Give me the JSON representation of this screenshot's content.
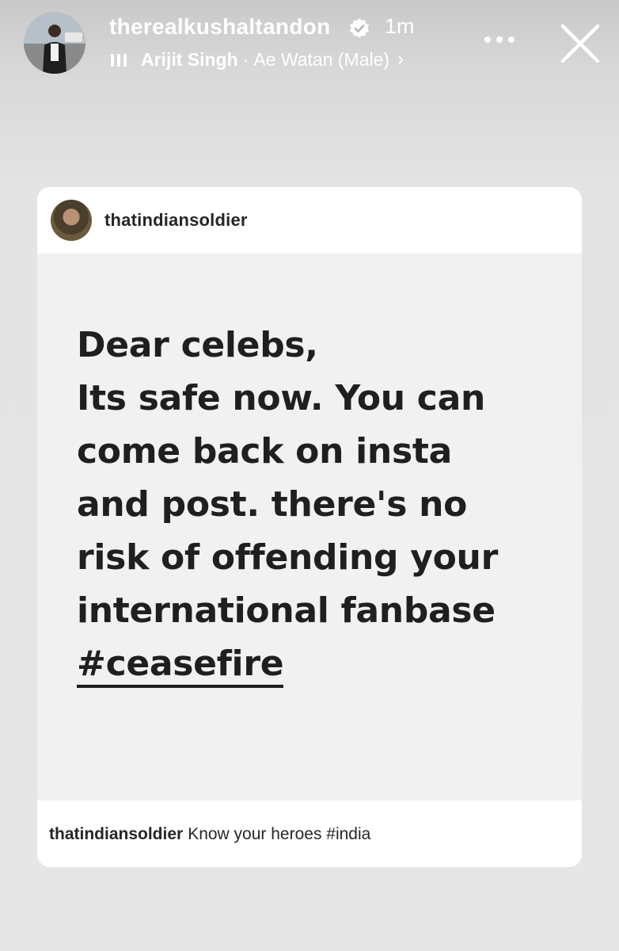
{
  "story": {
    "username": "therealkushaltandon",
    "time": "1m",
    "music": {
      "artist": "Arijit Singh",
      "separator": "·",
      "song": "Ae Watan (Male)",
      "chevron": "›"
    },
    "icons": {
      "verified": "verified-badge-icon",
      "music": "music-bars-icon",
      "more": "more-options-icon",
      "close": "close-icon"
    }
  },
  "post": {
    "username": "thatindiansoldier",
    "lines": [
      "Dear celebs,",
      "Its safe now. You can",
      "come back on insta",
      "and post. there's no",
      "risk of offending your",
      "international fanbase"
    ],
    "hashtag": "#ceasefire",
    "caption_user": "thatindiansoldier",
    "caption_text": "Know your heroes #india"
  },
  "colors": {
    "text_dark": "#1f1f1f",
    "card_bg": "#f1f1f1",
    "card_header_bg": "#ffffff",
    "page_bg": "#e6e6e6"
  }
}
